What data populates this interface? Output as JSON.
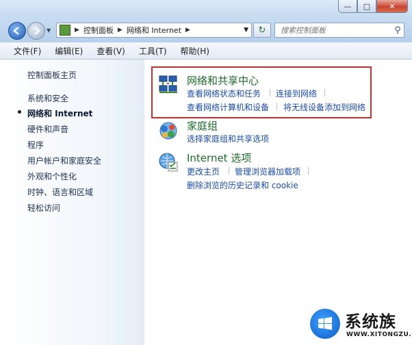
{
  "window": {
    "minimize": "—",
    "maximize": "□",
    "close": "✕"
  },
  "navigation": {
    "address_crumbs": [
      "控制面板",
      "网络和 Internet"
    ],
    "search_placeholder": "搜索控制面板"
  },
  "menu": [
    "文件(F)",
    "编辑(E)",
    "查看(V)",
    "工具(T)",
    "帮助(H)"
  ],
  "left_nav": {
    "home": "控制面板主页",
    "items": [
      "系统和安全",
      "网络和 Internet",
      "硬件和声音",
      "程序",
      "用户帐户和家庭安全",
      "外观和个性化",
      "时钟、语言和区域",
      "轻松访问"
    ],
    "active_index": 1
  },
  "categories": [
    {
      "title": "网络和共享中心",
      "links": [
        "查看网络状态和任务",
        "连接到网络",
        "查看网络计算机和设备",
        "将无线设备添加到网络"
      ]
    },
    {
      "title": "家庭组",
      "links": [
        "选择家庭组和共享选项"
      ]
    },
    {
      "title": "Internet 选项",
      "links": [
        "更改主页",
        "管理浏览器加载项",
        "删除浏览的历史记录和 cookie"
      ]
    }
  ],
  "watermark": {
    "brand": "系统族",
    "url": "WWW.XITONGZU.COM"
  }
}
